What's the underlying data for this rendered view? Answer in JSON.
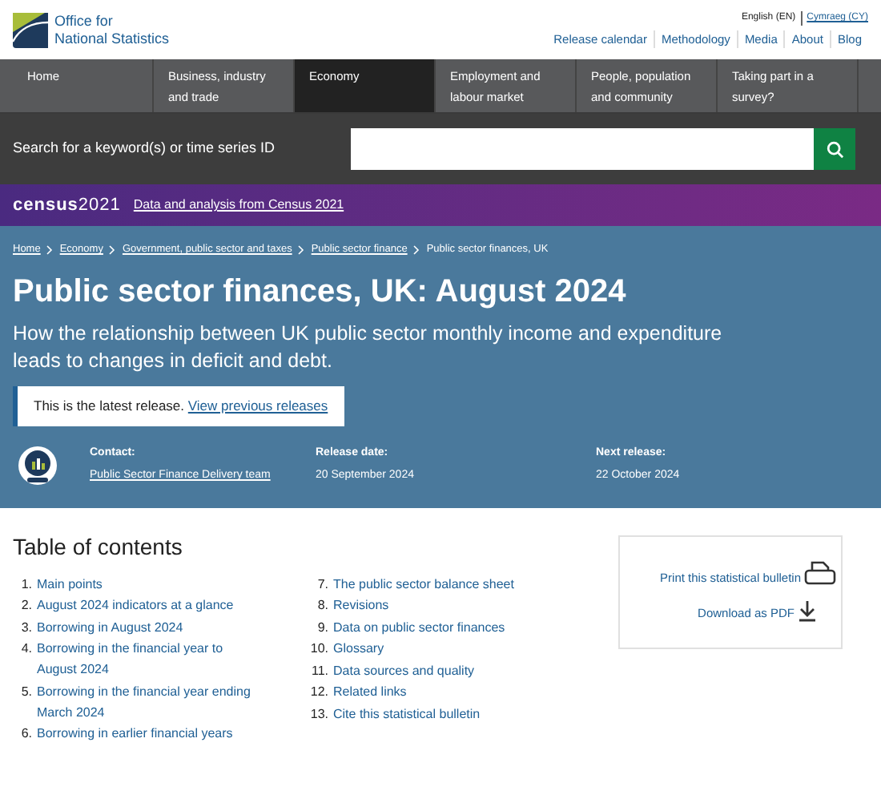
{
  "header": {
    "logo_lines": [
      "Office for",
      "National Statistics"
    ],
    "languages": [
      {
        "label": "English (EN)",
        "selected": true
      },
      {
        "label": "Cymraeg (CY)",
        "selected": false
      }
    ],
    "links": [
      "Release calendar",
      "Methodology",
      "Media",
      "About",
      "Blog"
    ]
  },
  "nav": [
    {
      "label": "Home",
      "selected": false
    },
    {
      "label": "Business, industry and trade",
      "selected": false
    },
    {
      "label": "Economy",
      "selected": true
    },
    {
      "label": "Employment and labour market",
      "selected": false
    },
    {
      "label": "People, population and community",
      "selected": false
    },
    {
      "label": "Taking part in a survey?",
      "selected": false
    }
  ],
  "search": {
    "label": "Search for a keyword(s) or time series ID"
  },
  "census_banner": {
    "logo_word": "census",
    "logo_year": "2021",
    "link": "Data and analysis from Census 2021"
  },
  "breadcrumbs": [
    {
      "label": "Home",
      "link": true
    },
    {
      "label": "Economy",
      "link": true
    },
    {
      "label": "Government, public sector and taxes",
      "link": true
    },
    {
      "label": "Public sector finance",
      "link": true
    },
    {
      "label": "Public sector finances, UK",
      "link": false
    }
  ],
  "title": "Public sector finances, UK: August 2024",
  "subtitle": "How the relationship between UK public sector monthly income and expenditure leads to changes in deficit and debt.",
  "release_notice": {
    "text": "This is the latest release.",
    "link": "View previous releases"
  },
  "meta": [
    {
      "label": "Contact:",
      "value": "Public Sector Finance Delivery team",
      "link": true
    },
    {
      "label": "Release date:",
      "value": "20 September 2024",
      "link": false
    },
    {
      "label": "Next release:",
      "value": "22 October 2024",
      "link": false
    }
  ],
  "toc": {
    "title": "Table of contents",
    "items": [
      {
        "number": "1.",
        "label": "Main points"
      },
      {
        "number": "2.",
        "label": "August 2024 indicators at a glance"
      },
      {
        "number": "3.",
        "label": "Borrowing in August 2024"
      },
      {
        "number": "4.",
        "label": "Borrowing in the financial year to August 2024"
      },
      {
        "number": "5.",
        "label": "Borrowing in the financial year ending March 2024"
      },
      {
        "number": "6.",
        "label": "Borrowing in earlier financial years"
      },
      {
        "number": "7.",
        "label": "The public sector balance sheet"
      },
      {
        "number": "8.",
        "label": "Revisions"
      },
      {
        "number": "9.",
        "label": "Data on public sector finances"
      },
      {
        "number": "10.",
        "label": "Glossary"
      },
      {
        "number": "11.",
        "label": "Data sources and quality"
      },
      {
        "number": "12.",
        "label": "Related links"
      },
      {
        "number": "13.",
        "label": "Cite this statistical bulletin"
      }
    ]
  },
  "actions": [
    {
      "kind": "print",
      "label": "Print this statistical bulletin"
    },
    {
      "kind": "download",
      "label": "Download as PDF"
    }
  ]
}
